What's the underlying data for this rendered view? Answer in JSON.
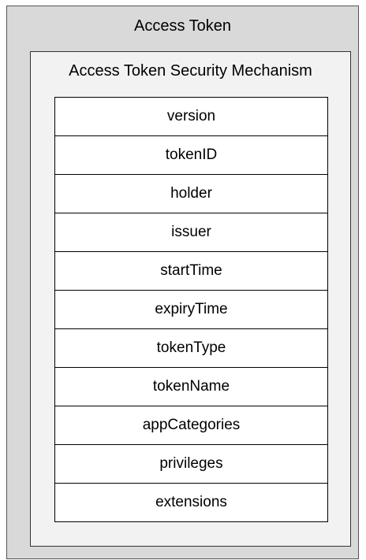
{
  "outer": {
    "title": "Access Token"
  },
  "inner": {
    "title": "Access Token Security Mechanism"
  },
  "fields": [
    "version",
    "tokenID",
    "holder",
    "issuer",
    "startTime",
    "expiryTime",
    "tokenType",
    "tokenName",
    "appCategories",
    "privileges",
    "extensions"
  ],
  "colors": {
    "outer_fill": "#d9d9d9",
    "inner_fill": "#f2f2f2",
    "table_fill": "#ffffff",
    "border": "#000000"
  }
}
